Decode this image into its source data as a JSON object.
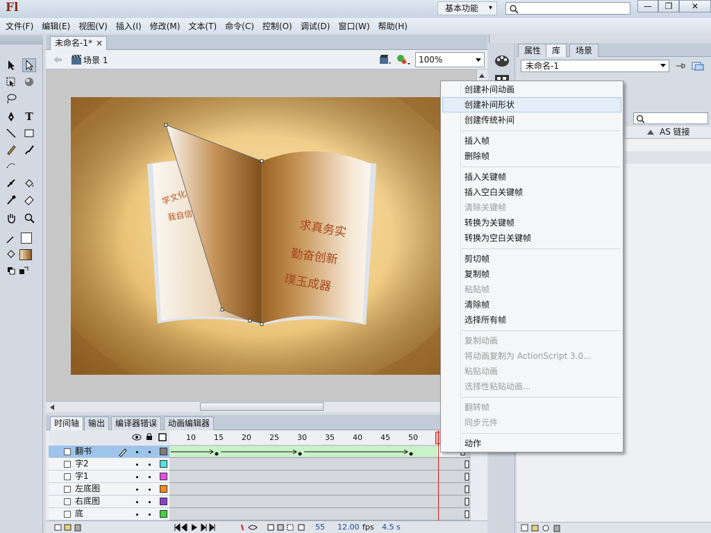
{
  "app": {
    "logo": "Fl",
    "workspace": "基本功能",
    "workspace_arrow": "▾"
  },
  "window_buttons": {
    "minimize": "—",
    "restore": "❐",
    "close": "✕"
  },
  "menubar": [
    "文件(F)",
    "编辑(E)",
    "视图(V)",
    "插入(I)",
    "修改(M)",
    "文本(T)",
    "命令(C)",
    "控制(O)",
    "调试(D)",
    "窗口(W)",
    "帮助(H)"
  ],
  "document": {
    "tab": "未命名-1*",
    "tab_close": "×",
    "scene": "场景 1",
    "zoom": "100%"
  },
  "stage_text": {
    "left_page": [
      "学文化",
      "我自信"
    ],
    "right_page": [
      "求真务实",
      "勤奋创新",
      "璞玉成器"
    ]
  },
  "timeline": {
    "tabs": [
      "时间轴",
      "输出",
      "编译器错误",
      "动画编辑器"
    ],
    "ruler": [
      "10",
      "15",
      "20",
      "25",
      "30",
      "35",
      "40",
      "45",
      "50"
    ],
    "layers": [
      {
        "name": "翻书",
        "color": "#7c7c7c",
        "selected": true
      },
      {
        "name": "字2",
        "color": "#4fe3e3",
        "selected": false
      },
      {
        "name": "字1",
        "color": "#e84fe8",
        "selected": false
      },
      {
        "name": "左底图",
        "color": "#f08a1c",
        "selected": false
      },
      {
        "name": "右底图",
        "color": "#8a3fc9",
        "selected": false
      },
      {
        "name": "底",
        "color": "#3fd13f",
        "selected": false
      }
    ],
    "footer": {
      "frame": "55",
      "fps": "12.00",
      "fps_unit": "fps",
      "time": "4.5 s"
    }
  },
  "panel": {
    "tabs": [
      "属性",
      "库",
      "场景"
    ],
    "library_doc": "未命名-1",
    "column": "AS 链接"
  },
  "context_menu": [
    {
      "label": "创建补间动画",
      "state": "normal"
    },
    {
      "label": "创建补间形状",
      "state": "hover"
    },
    {
      "label": "创建传统补间",
      "state": "normal"
    },
    {
      "label": "插入帧",
      "state": "normal"
    },
    {
      "label": "删除帧",
      "state": "normal"
    },
    {
      "label": "插入关键帧",
      "state": "normal"
    },
    {
      "label": "插入空白关键帧",
      "state": "normal"
    },
    {
      "label": "清除关键帧",
      "state": "disabled"
    },
    {
      "label": "转换为关键帧",
      "state": "normal"
    },
    {
      "label": "转换为空白关键帧",
      "state": "normal"
    },
    {
      "label": "剪切帧",
      "state": "normal"
    },
    {
      "label": "复制帧",
      "state": "normal"
    },
    {
      "label": "粘贴帧",
      "state": "disabled"
    },
    {
      "label": "清除帧",
      "state": "normal"
    },
    {
      "label": "选择所有帧",
      "state": "normal"
    },
    {
      "label": "复制动画",
      "state": "disabled"
    },
    {
      "label": "将动画复制为 ActionScript 3.0...",
      "state": "disabled"
    },
    {
      "label": "粘贴动画",
      "state": "disabled"
    },
    {
      "label": "选择性粘贴动画...",
      "state": "disabled"
    },
    {
      "label": "翻转帧",
      "state": "disabled"
    },
    {
      "label": "同步元件",
      "state": "disabled"
    },
    {
      "label": "动作",
      "state": "normal"
    }
  ]
}
